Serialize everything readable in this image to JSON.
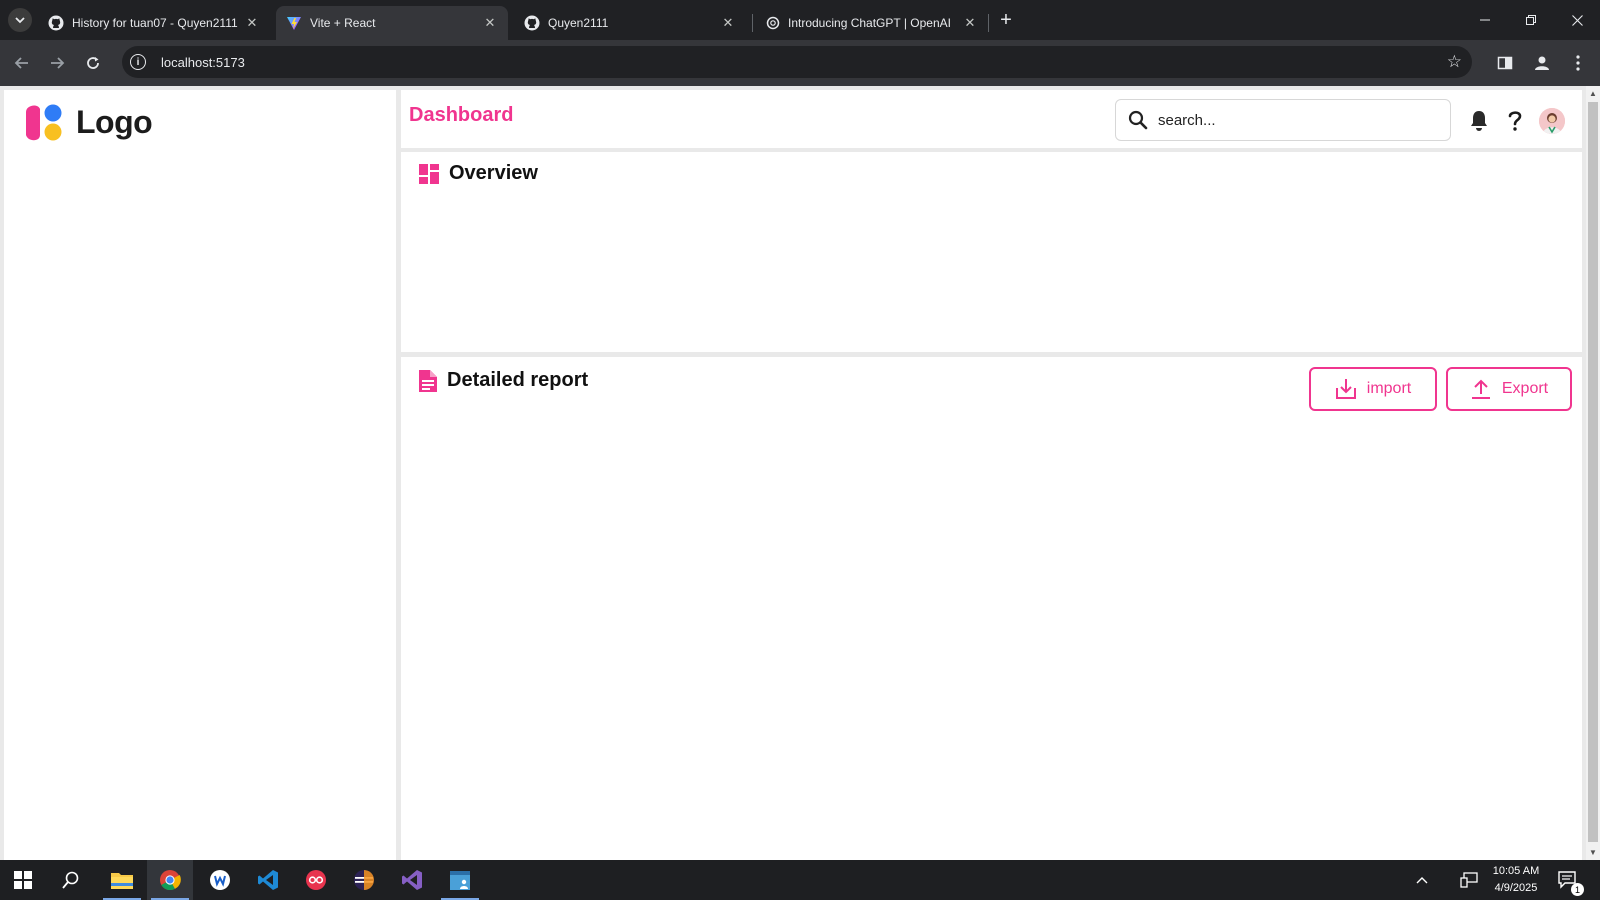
{
  "browser": {
    "tabs": [
      {
        "title": "History for tuan07 - Quyen2111",
        "icon": "github-icon",
        "active": false
      },
      {
        "title": "Vite + React",
        "icon": "vite-icon",
        "active": true
      },
      {
        "title": "Quyen2111",
        "icon": "github-icon",
        "active": false
      },
      {
        "title": "Introducing ChatGPT | OpenAI",
        "icon": "openai-icon",
        "active": false
      }
    ],
    "new_tab_label": "+",
    "url": "localhost:5173"
  },
  "app": {
    "logo_text": "Logo",
    "page_title": "Dashboard",
    "search": {
      "placeholder": "search..."
    },
    "header_icons": [
      "bell-icon",
      "help-icon",
      "avatar"
    ],
    "colors": {
      "accent": "#f0358f",
      "logo_pink": "#f0358f",
      "logo_blue": "#2f7cf6",
      "logo_yellow": "#f8c021"
    }
  },
  "overview": {
    "title": "Overview",
    "icon": "dashboard-icon"
  },
  "report": {
    "title": "Detailed report",
    "icon": "document-icon",
    "import_label": "import",
    "export_label": "Export"
  },
  "taskbar": {
    "apps": [
      "windows-start-icon",
      "search-icon",
      "file-explorer-icon",
      "chrome-icon",
      "writer-icon",
      "vscode-icon",
      "app-red-icon",
      "eclipse-icon",
      "visual-studio-icon",
      "app-blue-icon"
    ],
    "time": "10:05 AM",
    "date": "4/9/2025",
    "notification_count": "1"
  }
}
